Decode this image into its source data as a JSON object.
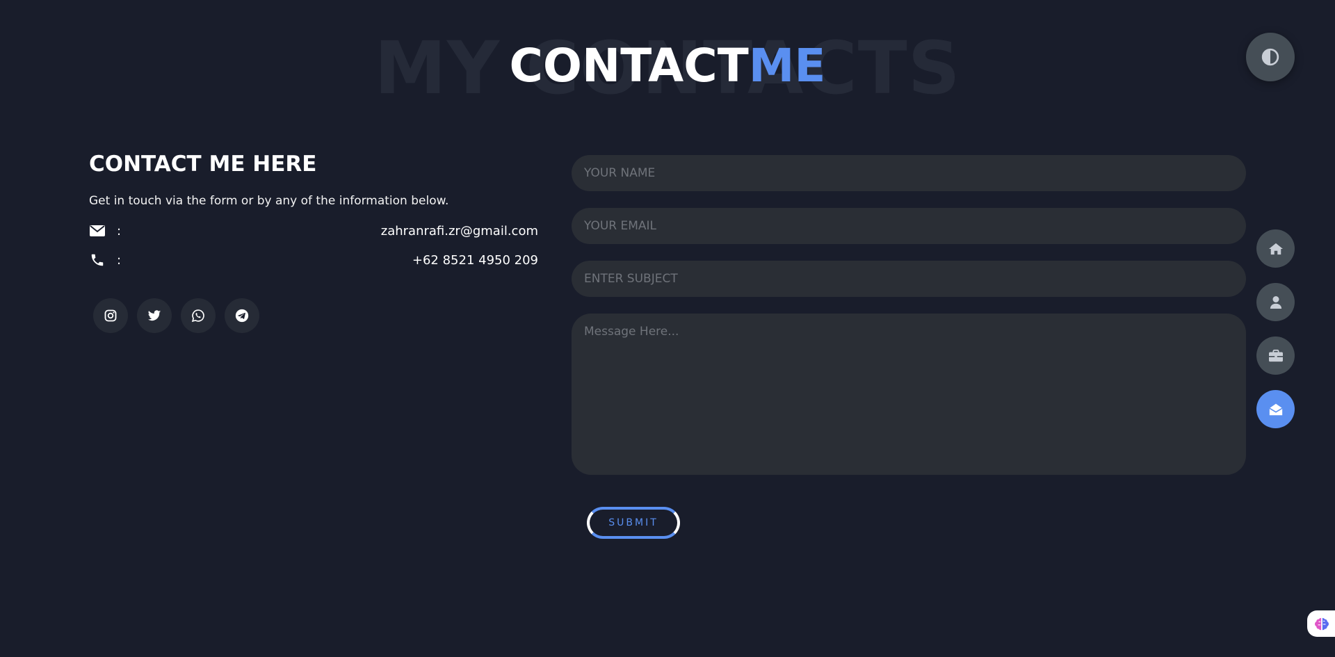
{
  "header": {
    "bg_title": "MY CONTACTS",
    "title_main": "CONTACT",
    "title_accent": "ME"
  },
  "contact": {
    "heading": "CONTACT ME HERE",
    "description": "Get in touch via the form or by any of the information below.",
    "email_icon": "envelope-icon",
    "email": "zahranrafi.zr@gmail.com",
    "phone_icon": "phone-icon",
    "phone": "+62 8521 4950 209",
    "separator": ":",
    "socials": [
      "instagram-icon",
      "twitter-icon",
      "whatsapp-icon",
      "telegram-icon"
    ]
  },
  "form": {
    "name_placeholder": "YOUR NAME",
    "email_placeholder": "YOUR EMAIL",
    "subject_placeholder": "ENTER SUBJECT",
    "message_placeholder": "Message Here...",
    "submit_label": "SUBMIT"
  },
  "nav": {
    "items": [
      "home-icon",
      "user-icon",
      "briefcase-icon",
      "envelope-open-icon"
    ],
    "active": "envelope-open-icon"
  },
  "theme_toggle_icon": "contrast-icon",
  "colors": {
    "background": "#191d2b",
    "accent": "#5a8ff0",
    "field": "#2a2e35",
    "nav_button": "#454e56"
  }
}
